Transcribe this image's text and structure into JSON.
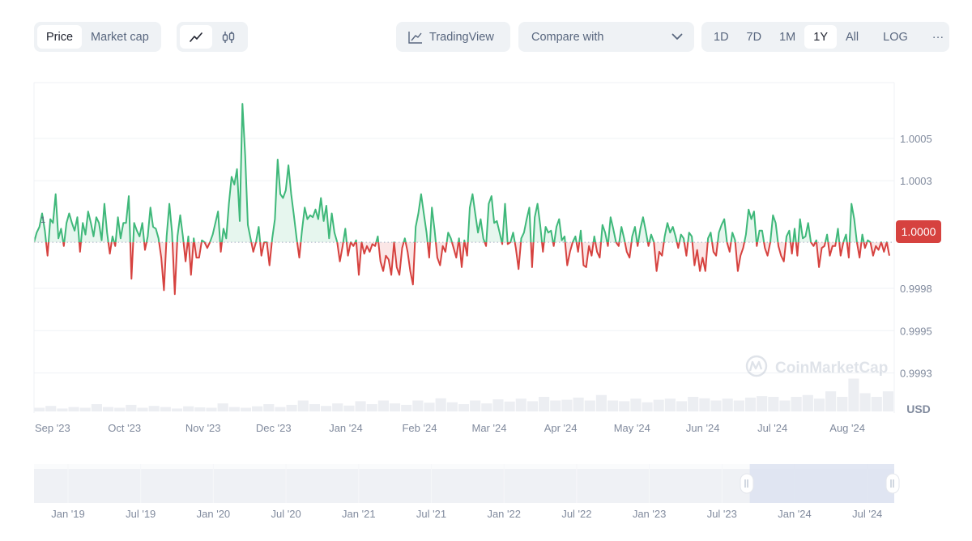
{
  "toolbar": {
    "data_type_tabs": [
      {
        "label": "Price",
        "active": true
      },
      {
        "label": "Market cap",
        "active": false
      }
    ],
    "chart_type_tabs": [
      {
        "icon": "line-chart-icon",
        "active": true
      },
      {
        "icon": "candlestick-icon",
        "active": false
      }
    ],
    "tradingview_label": "TradingView",
    "compare_label": "Compare with",
    "range_tabs": [
      {
        "label": "1D",
        "active": false
      },
      {
        "label": "7D",
        "active": false
      },
      {
        "label": "1M",
        "active": false
      },
      {
        "label": "1Y",
        "active": true
      },
      {
        "label": "All",
        "active": false
      }
    ],
    "log_label": "LOG",
    "more_label": "···"
  },
  "colors": {
    "up": "#3fb87a",
    "down": "#d6423f",
    "up_fill": "#e6f6ee",
    "down_fill": "#fbe6e6",
    "price_badge": "#d6423f",
    "grid": "#eff2f5",
    "navigator": "#eef0f4",
    "navigator_selected": "#dfe4f2"
  },
  "watermark": "CoinMarketCap",
  "chart_data": {
    "type": "line",
    "title": "",
    "xlabel": "",
    "ylabel": "USD",
    "baseline": 1.0,
    "baseline_label": "1",
    "current_price_label": "1.0000",
    "y_ticks": [
      "1.0005",
      "1.0003",
      "0.9998",
      "0.9995",
      "0.9993"
    ],
    "y_tick_values": [
      1.00054,
      1.00032,
      0.99976,
      0.99954,
      0.99932
    ],
    "ylim": [
      0.99912,
      1.00083
    ],
    "grid": true,
    "x_ticks": [
      "Sep '23",
      "Oct '23",
      "Nov '23",
      "Dec '23",
      "Jan '24",
      "Feb '24",
      "Mar '24",
      "Apr '24",
      "May '24",
      "Jun '24",
      "Jul '24",
      "Aug '24"
    ],
    "x_tick_positions": [
      0.0,
      0.085,
      0.175,
      0.257,
      0.342,
      0.427,
      0.508,
      0.592,
      0.673,
      0.757,
      0.84,
      0.924
    ],
    "series": [
      {
        "name": "Price",
        "values": [
          1.0,
          1.00005,
          1.00008,
          1.00015,
          1.00006,
          0.99993,
          1.00012,
          1.0001,
          1.00025,
          1.00002,
          1.00007,
          0.99998,
          1.0001,
          1.00015,
          1.0001,
          1.00006,
          1.00013,
          0.99995,
          1.0001,
          1.00004,
          1.00016,
          1.0001,
          1.00003,
          1.00013,
          1.0001,
          1.00001,
          1.0002,
          1.00005,
          0.99994,
          1.00003,
          0.99998,
          1.00013,
          1.00002,
          1.0001,
          1.0001,
          1.00024,
          0.99981,
          1.0001,
          1.00006,
          1.00003,
          1.0001,
          0.99996,
          1.00003,
          1.00018,
          1.00008,
          1.00007,
          1.00002,
          0.99992,
          0.99975,
          1.00003,
          1.0002,
          1.00005,
          0.99973,
          1.00003,
          1.00014,
          1.00003,
          0.9999,
          1.00003,
          0.99983,
          1.00002,
          0.99992,
          0.99992,
          1.00001,
          1.0,
          0.99997,
          1.0,
          1.00004,
          1.0001,
          1.00016,
          0.99995,
          1.00007,
          1.00002,
          1.0002,
          1.00034,
          1.0003,
          1.00038,
          1.00011,
          1.00072,
          1.00045,
          1.00009,
          1.00002,
          0.99995,
          1.0,
          1.00008,
          0.99993,
          1.0,
          1.0,
          0.99988,
          1.00002,
          1.00012,
          1.00043,
          1.00025,
          1.00023,
          1.00027,
          1.0004,
          1.00025,
          1.00014,
          1.00002,
          0.99992,
          1.00006,
          1.00018,
          1.00012,
          1.00014,
          1.00013,
          1.00017,
          1.00012,
          1.00023,
          1.00011,
          1.00019,
          1.00002,
          1.00015,
          1.00005,
          1.0,
          0.9999,
          0.99998,
          1.00007,
          0.99993,
          1.0,
          0.99998,
          1.00001,
          0.99983,
          1.0,
          0.99994,
          0.99998,
          0.99995,
          0.99999,
          0.99998,
          1.00003,
          0.9999,
          0.99985,
          0.99993,
          0.99991,
          0.99983,
          1.0,
          0.99987,
          0.99983,
          0.99997,
          1.00002,
          0.99995,
          0.99985,
          0.99978,
          1.00008,
          1.00015,
          1.00025,
          1.00015,
          1.00005,
          0.99992,
          1.00018,
          1.00006,
          0.99992,
          0.99988,
          0.99998,
          0.99995,
          1.00005,
          1.00002,
          0.99997,
          0.99992,
          1.00002,
          0.99987,
          1.00001,
          0.99993,
          1.00018,
          1.00025,
          1.00015,
          1.00005,
          1.00012,
          1.00002,
          0.99998,
          1.0002,
          1.00024,
          1.0001,
          1.00011,
          1.00005,
          0.99999,
          1.0002,
          0.99999,
          1.0,
          1.00005,
          0.99997,
          0.99986,
          1.00002,
          1.00005,
          1.00012,
          1.00018,
          0.99987,
          1.00013,
          1.0002,
          1.00009,
          0.99995,
          1.00008,
          1.00005,
          1.00006,
          0.99998,
          1.00008,
          1.00012,
          1.00001,
          1.00003,
          0.99988,
          0.99995,
          1.0,
          1.00003,
          0.99995,
          1.00006,
          0.99988,
          0.99987,
          0.99998,
          0.99993,
          1.00003,
          0.99995,
          0.99992,
          1.00009,
          1.00005,
          0.99998,
          1.00013,
          1.00007,
          1.0,
          0.99998,
          1.00008,
          1.00002,
          0.99995,
          0.99992,
          1.00003,
          1.00008,
          0.99998,
          1.00007,
          1.00013,
          1.00006,
          0.99998,
          1.00004,
          1.0,
          0.99985,
          0.99995,
          0.99993,
          1.00003,
          1.0001,
          1.00005,
          1.00008,
          1.00003,
          0.99997,
          1.00004,
          1.00002,
          0.99993,
          1.00005,
          1.00003,
          0.99988,
          0.99996,
          0.99985,
          0.99992,
          0.99985,
          1.00002,
          1.00005,
          0.99995,
          0.99993,
          1.00005,
          1.00009,
          1.00012,
          1.0,
          0.99995,
          1.00005,
          1.00001,
          0.99985,
          0.99993,
          0.99997,
          1.00004,
          1.00017,
          1.00012,
          1.00016,
          0.99998,
          1.00006,
          1.00006,
          0.99997,
          0.99993,
          1.0,
          1.00014,
          1.0001,
          0.99998,
          0.99993,
          0.9999,
          1.00003,
          1.00006,
          0.99994,
          1.00007,
          0.99993,
          1.00012,
          1.00002,
          1.00003,
          1.0001,
          1.0,
          0.99998,
          1.00001,
          0.99987,
          0.99997,
          0.99998,
          1.00004,
          0.99993,
          0.99998,
          0.99998,
          1.00007,
          0.99993,
          1.0,
          1.00004,
          0.99992,
          1.0002,
          1.00012,
          1.0,
          0.99992,
          1.00004,
          0.99997,
          1.00001,
          1.0,
          0.99993,
          0.99998,
          0.99996,
          1.0,
          0.99995,
          1.0,
          0.99993
        ]
      }
    ],
    "volume_series_normalized": [
      0.1,
      0.15,
      0.08,
      0.12,
      0.1,
      0.2,
      0.12,
      0.1,
      0.18,
      0.1,
      0.15,
      0.12,
      0.08,
      0.14,
      0.11,
      0.1,
      0.22,
      0.12,
      0.1,
      0.14,
      0.2,
      0.12,
      0.18,
      0.3,
      0.2,
      0.15,
      0.22,
      0.16,
      0.28,
      0.2,
      0.3,
      0.22,
      0.18,
      0.3,
      0.24,
      0.36,
      0.25,
      0.2,
      0.3,
      0.22,
      0.33,
      0.27,
      0.35,
      0.28,
      0.4,
      0.3,
      0.32,
      0.38,
      0.3,
      0.45,
      0.3,
      0.28,
      0.35,
      0.25,
      0.32,
      0.35,
      0.28,
      0.4,
      0.36,
      0.3,
      0.35,
      0.3,
      0.38,
      0.42,
      0.4,
      0.3,
      0.4,
      0.45,
      0.35,
      0.55,
      0.4,
      0.9,
      0.5,
      0.4,
      0.55
    ],
    "navigator": {
      "x_ticks": [
        "Jan '19",
        "Jul '19",
        "Jan '20",
        "Jul '20",
        "Jan '21",
        "Jul '21",
        "Jan '22",
        "Jul '22",
        "Jan '23",
        "Jul '23",
        "Jan '24",
        "Jul '24"
      ],
      "selected_range": [
        "Sep '23",
        "Aug '24"
      ],
      "selected_fraction": [
        0.832,
        1.0
      ]
    }
  }
}
